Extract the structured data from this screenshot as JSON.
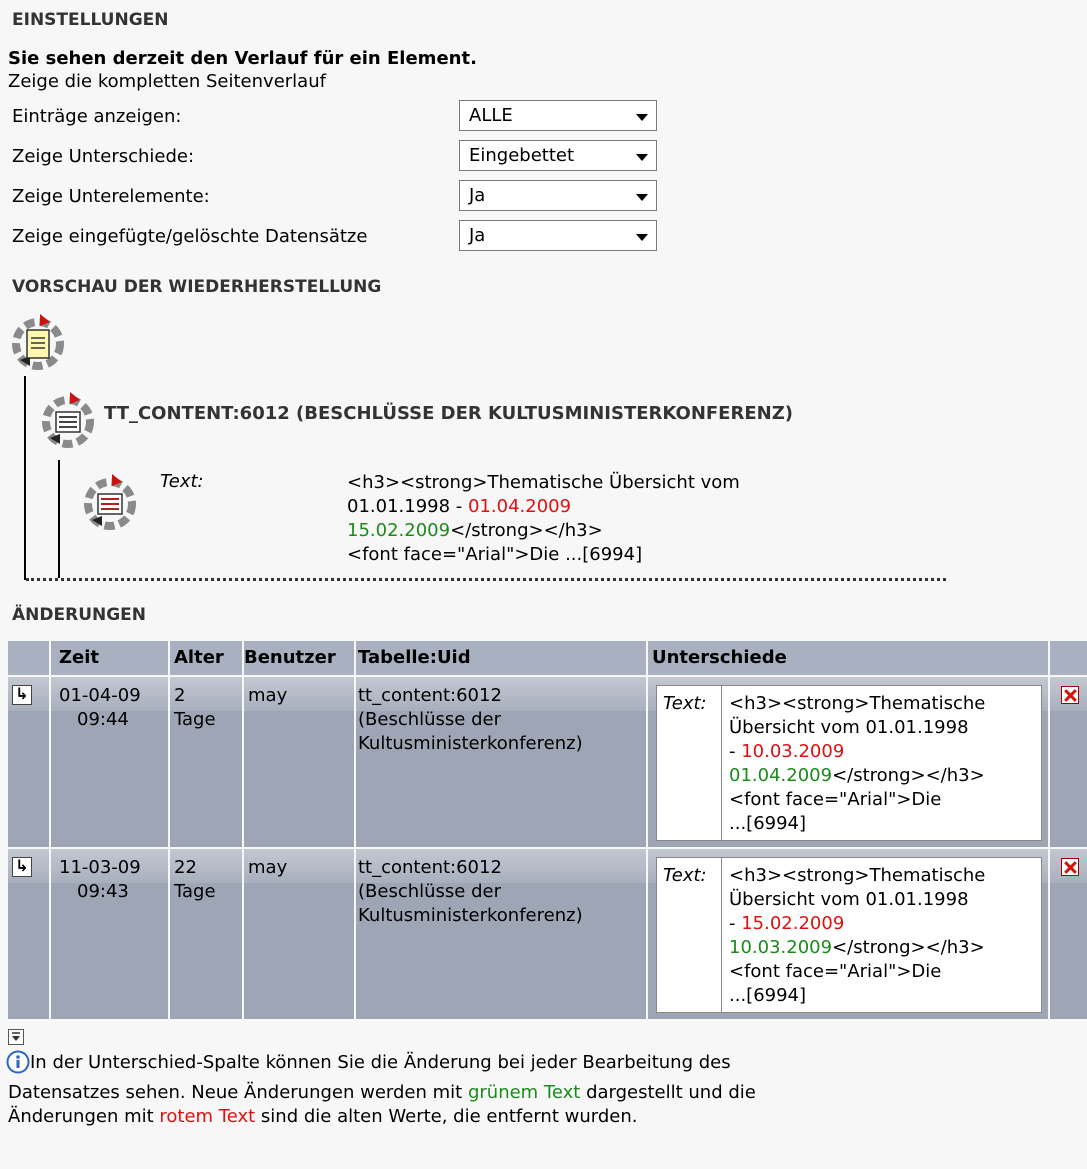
{
  "sections": {
    "settings": "EINSTELLUNGEN",
    "preview": "VORSCHAU DER WIEDERHERSTELLUNG",
    "changes": "ÄNDERUNGEN"
  },
  "info": {
    "title": "Sie sehen derzeit den Verlauf für ein Element.",
    "link": "Zeige die kompletten Seitenverlauf"
  },
  "options": [
    {
      "label": "Einträge anzeigen:",
      "value": "ALLE"
    },
    {
      "label": "Zeige Unterschiede:",
      "value": "Eingebettet"
    },
    {
      "label": "Zeige Unterelemente:",
      "value": "Ja"
    },
    {
      "label": "Zeige eingefügte/gelöschte Datensätze",
      "value": "Ja"
    }
  ],
  "preview_tree": {
    "record_title": "TT_CONTENT:6012 (BESCHLÜSSE DER KULTUSMINISTERKONFERENZ)",
    "field_label": "Text:",
    "line1": "<h3><strong>Thematische Übersicht vom",
    "line2_prefix": "01.01.1998 - ",
    "line2_old": "01.04.2009",
    "line3_new": "15.02.2009",
    "line3_suffix": "</strong></h3>",
    "line4": "<font face=\"Arial\">Die ...[6994]"
  },
  "table": {
    "headers": [
      "Zeit",
      "Alter",
      "Benutzer",
      "Tabelle:Uid",
      "Unterschiede"
    ],
    "rows": [
      {
        "time1": "01-04-09",
        "time2": "09:44",
        "age1": "2",
        "age2": "Tage",
        "user": "may",
        "uid1": "tt_content:6012",
        "uid2": "(Beschlüsse der",
        "uid3": "Kultusministerkonferenz)",
        "diff_label": "Text:",
        "d1": "<h3><strong>Thematische",
        "d2": "Übersicht vom 01.01.1998",
        "d3_prefix": "- ",
        "d3_old": "10.03.2009",
        "d4_new": "01.04.2009",
        "d4_suffix": "</strong></h3>",
        "d5": "<font face=\"Arial\">Die",
        "d6": "...[6994]"
      },
      {
        "time1": "11-03-09",
        "time2": "09:43",
        "age1": "22",
        "age2": "Tage",
        "user": "may",
        "uid1": "tt_content:6012",
        "uid2": "(Beschlüsse der",
        "uid3": "Kultusministerkonferenz)",
        "diff_label": "Text:",
        "d1": "<h3><strong>Thematische",
        "d2": "Übersicht vom 01.01.1998",
        "d3_prefix": "- ",
        "d3_old": "15.02.2009",
        "d4_new": "10.03.2009",
        "d4_suffix": "</strong></h3>",
        "d5": "<font face=\"Arial\">Die",
        "d6": "...[6994]"
      }
    ]
  },
  "help": {
    "line1": "In der Unterschied-Spalte können Sie die Änderung bei jeder Bearbeitung des",
    "line2_a": "Datensatzes sehen. Neue Änderungen werden mit ",
    "line2_green": "grünem Text",
    "line2_b": " dargestellt und die",
    "line3_a": "Änderungen mit ",
    "line3_red": "rotem Text",
    "line3_b": " sind die alten Werte, die entfernt wurden."
  },
  "colors": {
    "old": "#e01010",
    "new": "#1b8a1b",
    "table_bg": "#9ea6b5",
    "header_bg": "#a9b1c0"
  }
}
